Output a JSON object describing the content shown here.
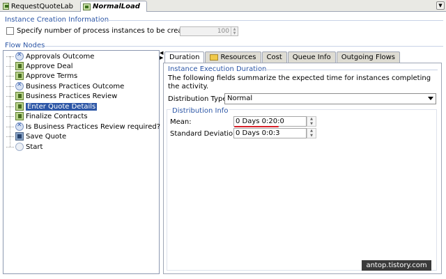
{
  "editor_tabs": [
    {
      "label": "RequestQuoteLab",
      "active": false,
      "icon": "process-icon"
    },
    {
      "label": "NormalLoad",
      "active": true,
      "icon": "process-icon"
    }
  ],
  "instance_creation": {
    "title": "Instance Creation Information",
    "checkbox_label": "Specify number of process instances to be created",
    "checked": false,
    "instances_value": "100"
  },
  "flow_nodes": {
    "title": "Flow Nodes",
    "items": [
      {
        "label": "Approvals Outcome",
        "icon": "outcome-icon"
      },
      {
        "label": "Approve Deal",
        "icon": "task-icon"
      },
      {
        "label": "Approve Terms",
        "icon": "task-icon"
      },
      {
        "label": "Business Practices Outcome",
        "icon": "outcome-icon"
      },
      {
        "label": "Business Practices Review",
        "icon": "task-icon"
      },
      {
        "label": "Enter Quote Details",
        "icon": "task-icon",
        "selected": true
      },
      {
        "label": "Finalize Contracts",
        "icon": "task-icon"
      },
      {
        "label": "Is Business Practices Review required?",
        "icon": "outcome-icon"
      },
      {
        "label": "Save Quote",
        "icon": "save-icon"
      },
      {
        "label": "Start",
        "icon": "start-icon"
      }
    ]
  },
  "detail_tabs": [
    "Duration",
    "Resources",
    "Cost",
    "Queue Info",
    "Outgoing Flows"
  ],
  "duration": {
    "section_title": "Instance Execution Duration",
    "description": "The following fields summarize the expected time for instances completing the activity.",
    "distribution_type_label": "Distribution Type:",
    "distribution_type_value": "Normal",
    "distribution_info_title": "Distribution Info",
    "mean_label": "Mean:",
    "mean_value": "0 Days 0:20:0",
    "sd_label": "Standard Deviation:",
    "sd_value": "0 Days 0:0:3"
  },
  "watermark": "antop.tistory.com",
  "colors": {
    "section_title": "#2c56a6",
    "selection": "#2c56a6",
    "annotation_underline": "#d8202a"
  }
}
